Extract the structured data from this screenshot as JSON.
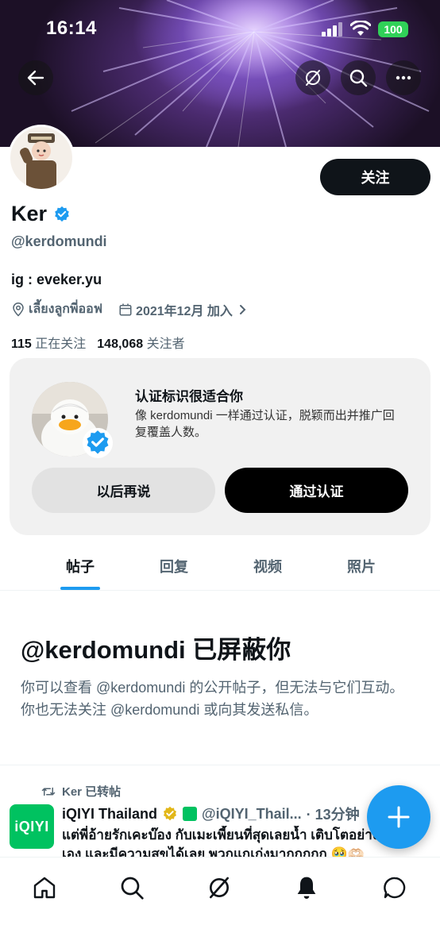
{
  "status": {
    "time": "16:14",
    "battery": "100"
  },
  "nav": {
    "back_icon": "back-arrow-icon",
    "grok_icon": "grok-icon",
    "search_icon": "search-icon",
    "more_icon": "more-icon"
  },
  "profile": {
    "name": "Ker",
    "handle": "@kerdomundi",
    "bio": "ig : eveker.yu",
    "location": "เลี้ยงลูกพี่ออฟ",
    "joined": "2021年12月 加入",
    "following_count": "115",
    "following_label": "正在关注",
    "followers_count": "148,068",
    "followers_label": "关注者",
    "follow_button": "关注"
  },
  "verify_card": {
    "title": "认证标识很适合你",
    "description": "像 kerdomundi 一样通过认证，脱颖而出并推广回复覆盖人数。",
    "later_button": "以后再说",
    "verify_button": "通过认证"
  },
  "tabs": [
    "帖子",
    "回复",
    "视频",
    "照片"
  ],
  "blocked": {
    "title": "@kerdomundi 已屏蔽你",
    "description": "你可以查看 @kerdomundi 的公开帖子，但无法与它们互动。你也无法关注 @kerdomundi 或向其发送私信。"
  },
  "tweet": {
    "retweet_label": "Ker 已转帖",
    "author_logo": "iQIYI",
    "author_name": "iQIYI Thailand",
    "author_handle": "@iQIYI_Thail...",
    "time": "· 13分钟",
    "body": "แต่พี่อ้ายรักเคะบ๊อง กับเมะเพี้ยนที่สุดเลยน้ำ เติบโตอย่างเป็นตัวเอง และมีความสุขได้เลย พวกแกเก่งมากกกกก 🥹🫶🏻"
  },
  "colors": {
    "accent": "#1d9bf0",
    "verified": "#1d9bf0",
    "text": "#0f1419",
    "secondary": "#536471"
  }
}
